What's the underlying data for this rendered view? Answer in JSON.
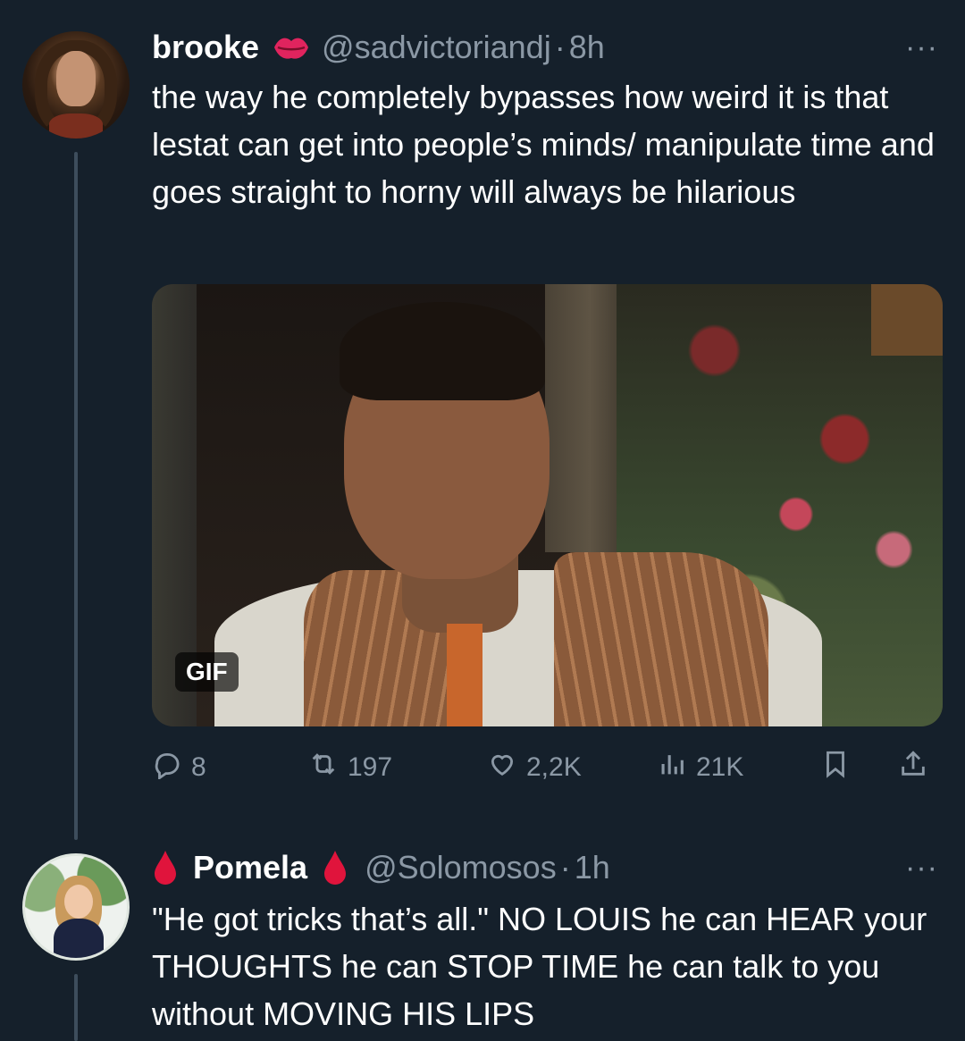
{
  "tweet1": {
    "name": "brooke",
    "badge_icon": "lips-icon",
    "handle": "@sadvictoriandj",
    "separator": "·",
    "time": "8h",
    "more": "···",
    "text": "the way he completely bypasses how weird it is that lestat can get into people’s minds/ manipulate time and goes straight to horny will always be hilarious",
    "media_badge": "GIF",
    "stats": {
      "replies": "8",
      "retweets": "197",
      "likes": "2,2K",
      "views": "21K"
    }
  },
  "tweet2": {
    "name": "Pomela",
    "badge_icon": "blood-drop-icon",
    "handle": "@Solomosos",
    "separator": "·",
    "time": "1h",
    "more": "···",
    "text": "\"He got tricks that’s all.\" NO LOUIS he can HEAR your THOUGHTS he can STOP TIME he can talk to you without MOVING HIS LIPS"
  },
  "colors": {
    "background": "#15202b",
    "text": "#ffffff",
    "muted": "#8b98a5",
    "thread": "#3d4d5c",
    "badge_red": "#e0245e"
  }
}
